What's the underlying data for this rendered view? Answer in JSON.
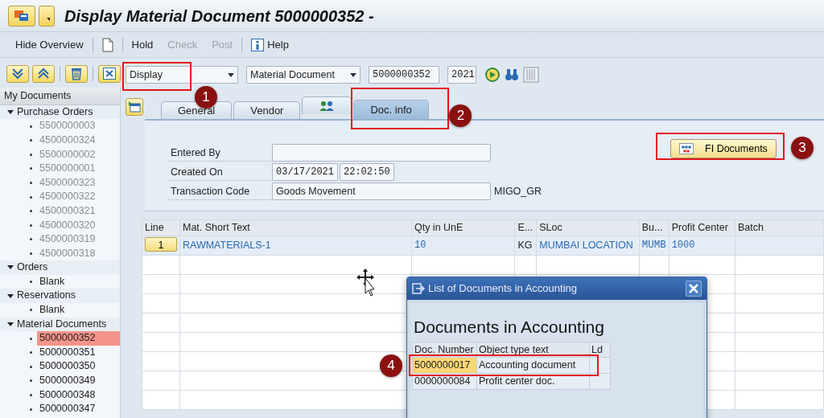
{
  "window": {
    "title": "Display Material Document 5000000352 -"
  },
  "toolbar": [
    {
      "kind": "text",
      "label": "Hide Overview",
      "disabled": false
    },
    {
      "kind": "separator"
    },
    {
      "kind": "icon"
    },
    {
      "kind": "separator"
    },
    {
      "kind": "text",
      "label": "Hold",
      "disabled": false
    },
    {
      "kind": "text",
      "label": "Check",
      "disabled": true
    },
    {
      "kind": "text",
      "label": "Post",
      "disabled": true
    },
    {
      "kind": "separator"
    },
    {
      "kind": "help",
      "label": "Help",
      "disabled": false
    }
  ],
  "sidebar": {
    "title": "My Documents",
    "groups": [
      {
        "label": "Purchase Orders",
        "expanded": true,
        "children": [
          {
            "label": "5500000003",
            "disabled": true,
            "selected": false
          },
          {
            "label": "4500000324",
            "disabled": true,
            "selected": false
          },
          {
            "label": "5500000002",
            "disabled": true,
            "selected": false
          },
          {
            "label": "5500000001",
            "disabled": true,
            "selected": false
          },
          {
            "label": "4500000323",
            "disabled": true,
            "selected": false
          },
          {
            "label": "4500000322",
            "disabled": true,
            "selected": false
          },
          {
            "label": "4500000321",
            "disabled": true,
            "selected": false
          },
          {
            "label": "4500000320",
            "disabled": true,
            "selected": false
          },
          {
            "label": "4500000319",
            "disabled": true,
            "selected": false
          },
          {
            "label": "4500000318",
            "disabled": true,
            "selected": false
          }
        ]
      },
      {
        "label": "Orders",
        "expanded": true,
        "children": [
          {
            "label": "Blank",
            "disabled": false,
            "selected": false
          }
        ]
      },
      {
        "label": "Reservations",
        "expanded": true,
        "children": [
          {
            "label": "Blank",
            "disabled": false,
            "selected": false
          }
        ]
      },
      {
        "label": "Material Documents",
        "expanded": true,
        "children": [
          {
            "label": "5000000352",
            "disabled": false,
            "selected": true
          },
          {
            "label": "5000000351",
            "disabled": false,
            "selected": false
          },
          {
            "label": "5000000350",
            "disabled": false,
            "selected": false
          },
          {
            "label": "5000000349",
            "disabled": false,
            "selected": false
          },
          {
            "label": "5000000348",
            "disabled": false,
            "selected": false
          },
          {
            "label": "5000000347",
            "disabled": false,
            "selected": false
          }
        ]
      }
    ]
  },
  "query": {
    "action": {
      "value": "Display",
      "callout": "1"
    },
    "reference": {
      "value": "Material Document"
    },
    "number": "5000000352",
    "year": "2021"
  },
  "tabs": [
    {
      "kind": "text",
      "label": "General",
      "selected": false
    },
    {
      "kind": "text",
      "label": "Vendor",
      "selected": false
    },
    {
      "kind": "icon",
      "selected": false
    },
    {
      "kind": "text",
      "label": "Doc. info",
      "selected": true,
      "callout": "2"
    }
  ],
  "doc_info": {
    "fields": [
      {
        "label": "Entered By"
      },
      {
        "label": "Created On",
        "values": [
          "03/17/2021",
          "22:02:50"
        ]
      },
      {
        "label": "Transaction Code",
        "values": [
          "Goods Movement"
        ],
        "suffix": "MIGO_GR"
      }
    ],
    "fi_button": {
      "label": "FI Documents",
      "callout": "3"
    }
  },
  "table": {
    "columns": [
      "Line",
      "Mat. Short Text",
      "Qty in UnE",
      "E...",
      "SLoc",
      "Bu...",
      "Profit Center",
      "Batch"
    ],
    "rows": [
      {
        "cells": [
          "1",
          "RAWMATERIALS-1",
          "10",
          "KG",
          "MUMBAI LOCATION",
          "MUMB",
          "1000"
        ]
      }
    ]
  },
  "dialog": {
    "title": "List of Documents in Accounting",
    "heading": "Documents in Accounting",
    "columns": [
      "Doc. Number",
      "Object type text",
      "Ld"
    ],
    "rows": [
      {
        "cells": [
          "5000000017",
          "Accounting document"
        ],
        "selected": true,
        "callout": "4"
      },
      {
        "cells": [
          "0000000084",
          "Profit center doc."
        ],
        "selected": false
      }
    ]
  }
}
